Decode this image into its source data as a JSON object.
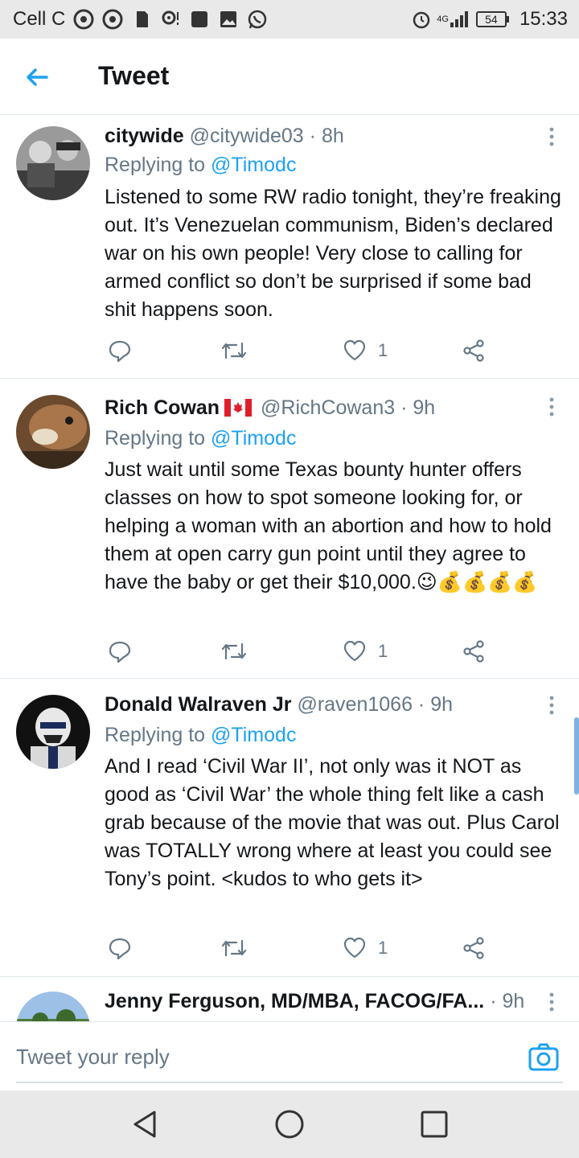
{
  "status_bar": {
    "carrier": "Cell C",
    "battery": "54",
    "signal": "4G",
    "time": "15:33"
  },
  "header": {
    "title": "Tweet"
  },
  "tweets": [
    {
      "name": "citywide",
      "handle": "@citywide03",
      "separator": "·",
      "time": "8h",
      "replying_prefix": "Replying to",
      "replying_to": "@Timodc",
      "text": "Listened to some RW radio tonight, they’re freaking out. It’s Venezuelan communism, Biden’s declared war on his own people! Very close to calling for armed conflict so don’t be surprised if some bad shit happens soon.",
      "likes": "1"
    },
    {
      "name": "Rich Cowan",
      "handle": "@RichCowan3",
      "separator": "·",
      "time": "9h",
      "replying_prefix": "Replying to",
      "replying_to": "@Timodc",
      "text": "Just wait until some Texas bounty hunter offers classes on how to spot someone looking for, or helping a woman with an abortion and how to hold them at open carry gun point until they agree to have the baby or get their $10,000.😉💰💰💰💰",
      "likes": "1"
    },
    {
      "name": "Donald Walraven Jr",
      "handle": "@raven1066",
      "separator": "·",
      "time": "9h",
      "replying_prefix": "Replying to",
      "replying_to": "@Timodc",
      "text": "And I read ‘Civil War II’, not only was it NOT as good as ‘Civil War’ the whole thing felt like a cash grab because of the movie that was out. Plus Carol was TOTALLY wrong where at least you could see Tony’s point. <kudos to who gets it>",
      "likes": "1"
    },
    {
      "name": "Jenny Ferguson, MD/MBA, FACOG/FA...",
      "separator": "·",
      "time": "9h"
    }
  ],
  "reply_bar": {
    "placeholder": "Tweet your reply"
  },
  "colors": {
    "accent": "#1da1f2",
    "text_primary": "#14171a",
    "text_secondary": "#657786",
    "divider": "#e1e8ed",
    "system_bar": "#e9e9ea"
  },
  "icons": [
    "chrome-icon",
    "sd-card-icon",
    "location-icon",
    "image-icon",
    "whatsapp-icon",
    "alarm-icon",
    "back-arrow-icon",
    "more-vert-icon",
    "reply-icon",
    "retweet-icon",
    "heart-icon",
    "share-icon",
    "camera-icon",
    "nav-back-icon",
    "nav-home-icon",
    "nav-recents-icon"
  ]
}
